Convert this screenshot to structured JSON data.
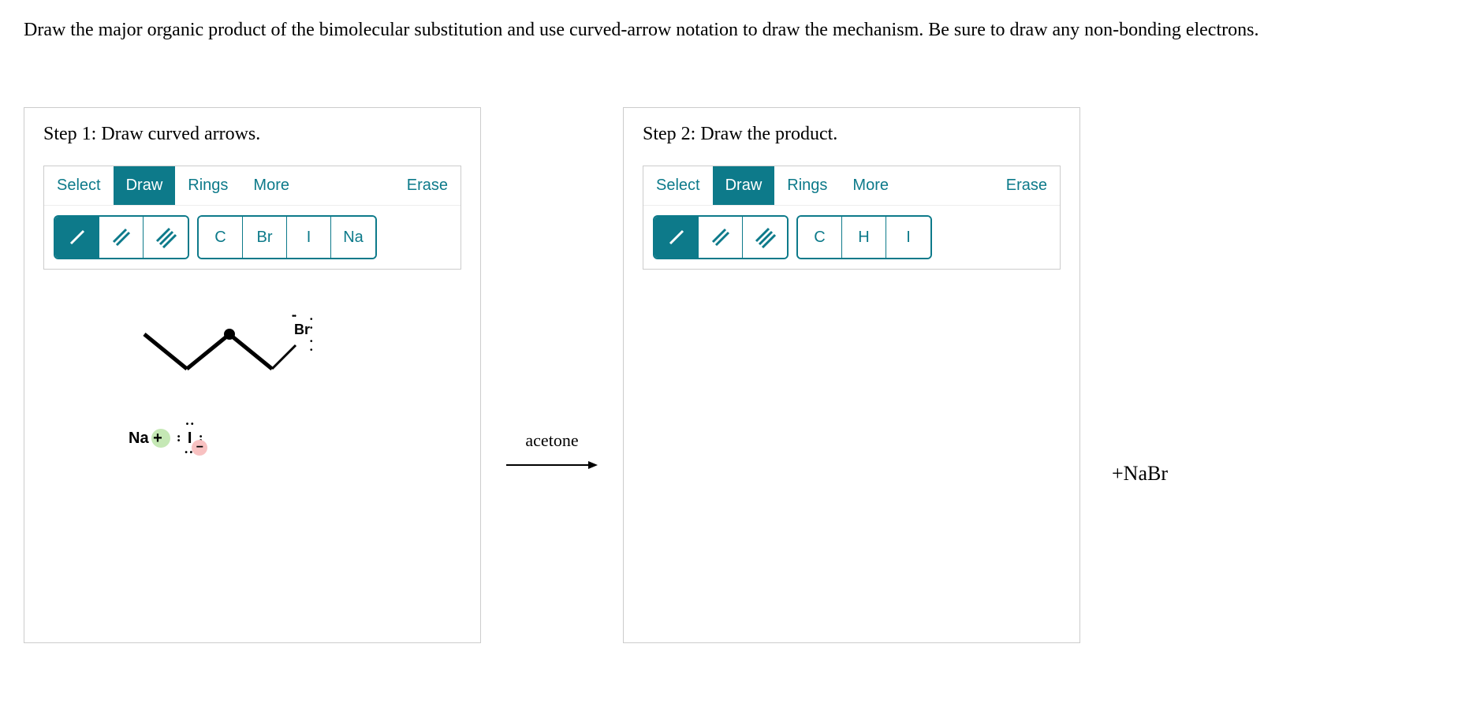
{
  "question": {
    "text": "Draw the major organic product of the bimolecular substitution and use curved-arrow notation to draw the mechanism. Be sure to draw any non-bonding electrons."
  },
  "panel1": {
    "title": "Step 1: Draw curved arrows.",
    "tabs": {
      "select": "Select",
      "draw": "Draw",
      "rings": "Rings",
      "more": "More",
      "erase": "Erase"
    },
    "elements": [
      "C",
      "Br",
      "I",
      "Na"
    ],
    "molecule": {
      "leaving_group": "Br",
      "nucleophile_cation": "Na +",
      "nucleophile_anion": "I",
      "anion_charge": "−"
    }
  },
  "reaction": {
    "solvent": "acetone"
  },
  "panel2": {
    "title": "Step 2: Draw the product.",
    "tabs": {
      "select": "Select",
      "draw": "Draw",
      "rings": "Rings",
      "more": "More",
      "erase": "Erase"
    },
    "elements": [
      "C",
      "H",
      "I"
    ]
  },
  "byproduct": "+NaBr"
}
